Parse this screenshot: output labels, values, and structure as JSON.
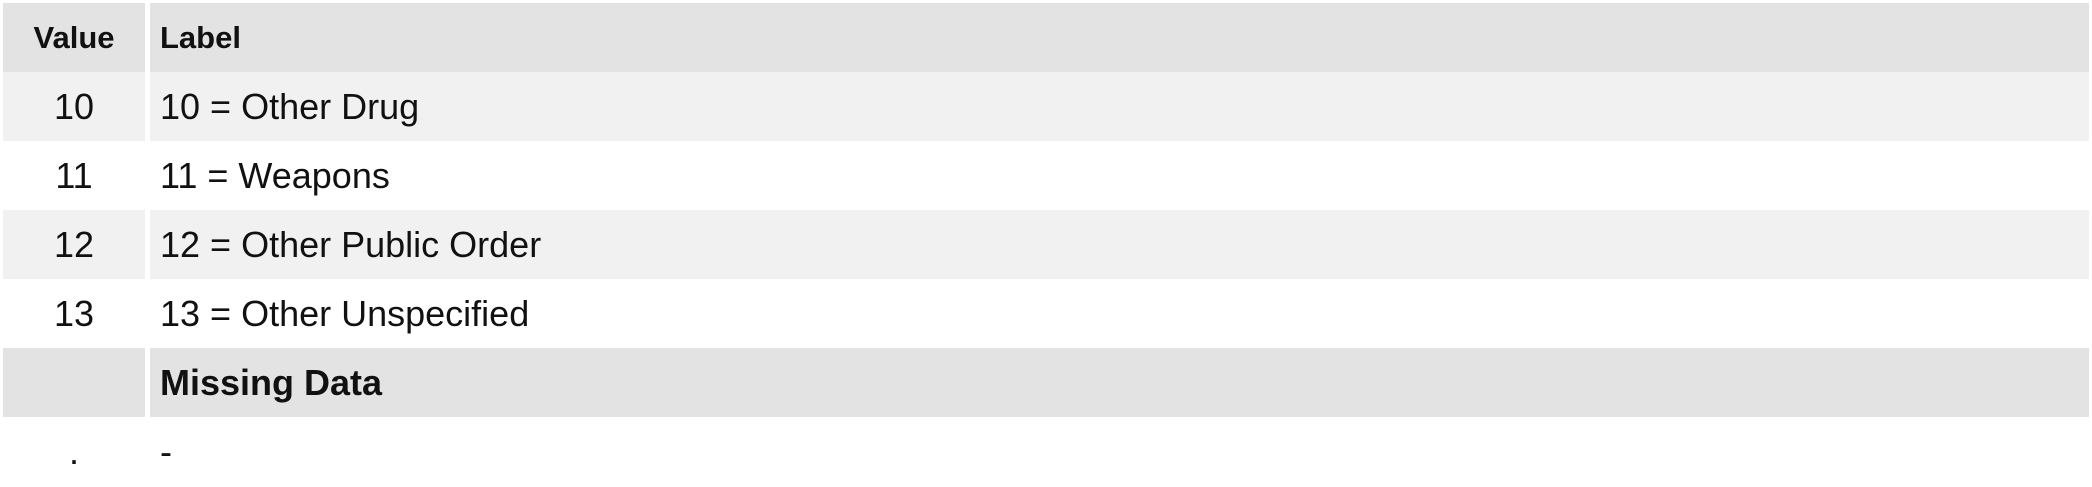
{
  "table": {
    "header": {
      "value": "Value",
      "label": "Label"
    },
    "rows": [
      {
        "value": "10",
        "label": "10 = Other Drug"
      },
      {
        "value": "11",
        "label": "11 = Weapons"
      },
      {
        "value": "12",
        "label": "12 = Other Public Order"
      },
      {
        "value": "13",
        "label": "13 = Other Unspecified"
      }
    ],
    "missing_section": {
      "value": "",
      "label": "Missing Data"
    },
    "missing_rows": [
      {
        "value": ".",
        "label": "-"
      }
    ]
  }
}
